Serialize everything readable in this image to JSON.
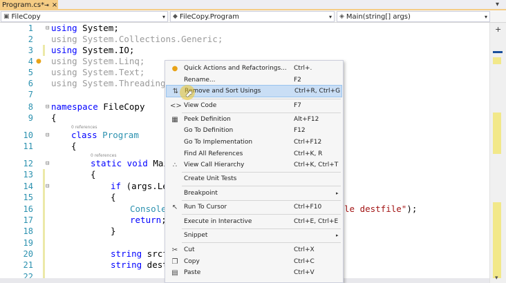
{
  "tab": {
    "title": "Program.cs*",
    "pin": "⇥",
    "close": "×",
    "overflow": "▾"
  },
  "nav": {
    "project": "FileCopy",
    "class": "FileCopy.Program",
    "member": "Main(string[] args)",
    "add": "+"
  },
  "editor": {
    "lines": [
      "1",
      "2",
      "3",
      "4",
      "5",
      "6",
      "7",
      "8",
      "9",
      "10",
      "11",
      "12",
      "13",
      "14",
      "15",
      "16",
      "17",
      "18",
      "19",
      "20",
      "21",
      "22"
    ],
    "code": {
      "l1_kw": "using",
      "l1_rest": " System;",
      "l2": "using System.Collections.Generic;",
      "l3_kw": "using",
      "l3_rest": " System.IO;",
      "l4": "using System.Linq;",
      "l5": "using System.Text;",
      "l6": "using System.Threading.",
      "l8_kw": "namespace",
      "l8_rest": " FileCopy",
      "l9": "{",
      "l10_kw": "class",
      "l10_ty": " Program",
      "l11": "{",
      "l12_kw": "static void",
      "l12_rest": " Mai",
      "l13": "{",
      "l14_kw": "if",
      "l14_rest": " (args.Le",
      "l15": "{",
      "l16_ty": "Console",
      "l16_str": "le destfile\"",
      "l16_end": ");",
      "l17_kw": "return",
      "l17_rest": ";",
      "l18": "}",
      "l20_kw": "string",
      "l20_rest": " srcf",
      "l21_kw": "string",
      "l21_rest": " dest"
    },
    "references": "0 references"
  },
  "context_menu": {
    "items": [
      {
        "label": "Quick Actions and Refactorings...",
        "shortcut": "Ctrl+.",
        "icon": "lightbulb-icon"
      },
      {
        "label": "Rename...",
        "shortcut": "F2",
        "icon": ""
      },
      {
        "label": "Remove and Sort Usings",
        "shortcut": "Ctrl+R, Ctrl+G",
        "icon": "sort-usings-icon"
      },
      {
        "label": "View Code",
        "shortcut": "F7",
        "icon": "code-icon"
      },
      {
        "label": "Peek Definition",
        "shortcut": "Alt+F12",
        "icon": "peek-icon"
      },
      {
        "label": "Go To Definition",
        "shortcut": "F12",
        "icon": ""
      },
      {
        "label": "Go To Implementation",
        "shortcut": "Ctrl+F12",
        "icon": ""
      },
      {
        "label": "Find All References",
        "shortcut": "Ctrl+K, R",
        "icon": ""
      },
      {
        "label": "View Call Hierarchy",
        "shortcut": "Ctrl+K, Ctrl+T",
        "icon": "hierarchy-icon"
      },
      {
        "label": "Create Unit Tests",
        "shortcut": "",
        "icon": ""
      },
      {
        "label": "Breakpoint",
        "shortcut": "",
        "icon": ""
      },
      {
        "label": "Run To Cursor",
        "shortcut": "Ctrl+F10",
        "icon": "run-cursor-icon"
      },
      {
        "label": "Execute in Interactive",
        "shortcut": "Ctrl+E, Ctrl+E",
        "icon": ""
      },
      {
        "label": "Snippet",
        "shortcut": "",
        "icon": ""
      },
      {
        "label": "Cut",
        "shortcut": "Ctrl+X",
        "icon": "scissors-icon"
      },
      {
        "label": "Copy",
        "shortcut": "Ctrl+C",
        "icon": "copy-icon"
      },
      {
        "label": "Paste",
        "shortcut": "Ctrl+V",
        "icon": "paste-icon"
      }
    ],
    "submenu_arrow": "▸"
  },
  "colors": {
    "tab_active": "#f5cc84",
    "keyword": "#0000ff",
    "type": "#2b91af",
    "string": "#a31515",
    "highlight": "#c9def5"
  }
}
